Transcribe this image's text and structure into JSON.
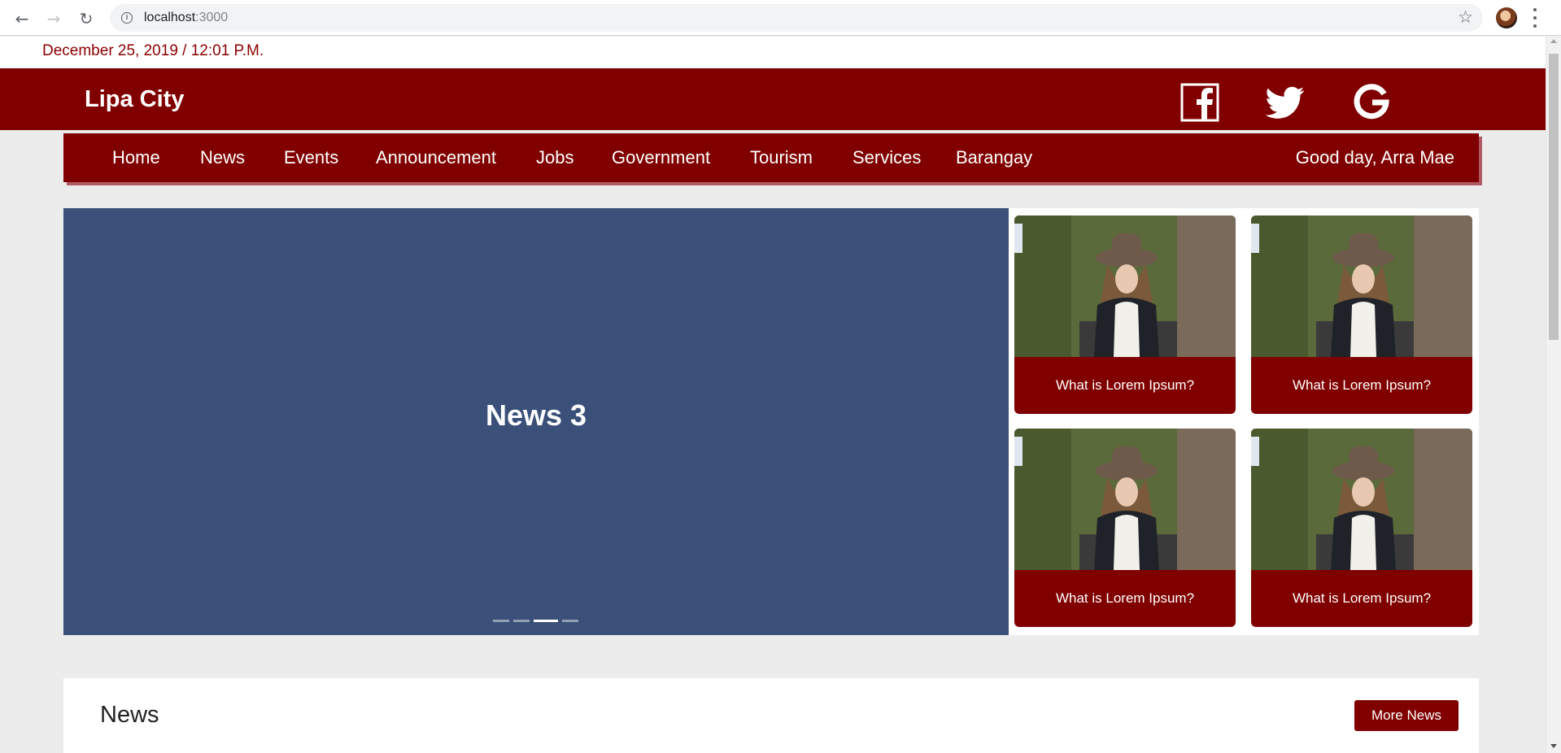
{
  "browser": {
    "url_host": "localhost",
    "url_port": ":3000",
    "icons": [
      "back-icon",
      "forward-icon",
      "reload-icon",
      "info-icon",
      "star-icon",
      "profile-avatar",
      "menu-icon"
    ]
  },
  "page": {
    "datetime": "December 25, 2019 / 12:01 P.M.",
    "brand": "Lipa City",
    "social_icons": [
      "facebook-icon",
      "twitter-icon",
      "google-icon"
    ],
    "nav": {
      "items": [
        "Home",
        "News",
        "Events",
        "Announcement",
        "Jobs",
        "Government",
        "Tourism",
        "Services",
        "Barangay"
      ],
      "greeting": "Good day, Arra Mae"
    },
    "carousel": {
      "title": "News 3",
      "indicator_count": 4,
      "active_index": 2
    },
    "cards": [
      {
        "caption": "What is Lorem Ipsum?"
      },
      {
        "caption": "What is Lorem Ipsum?"
      },
      {
        "caption": "What is Lorem Ipsum?"
      },
      {
        "caption": "What is Lorem Ipsum?"
      }
    ],
    "news": {
      "title": "News",
      "more_button": "More News"
    }
  },
  "colors": {
    "brand_red": "#800000",
    "carousel_blue": "#3a5079",
    "page_bg": "#ececec"
  }
}
